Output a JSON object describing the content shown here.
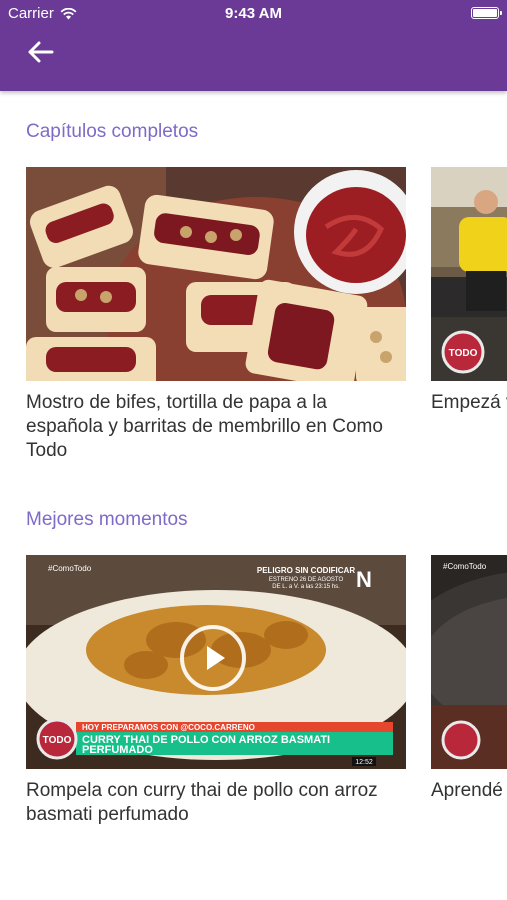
{
  "status_bar": {
    "carrier": "Carrier",
    "time": "9:43 AM"
  },
  "sections": [
    {
      "title": "Capítulos completos",
      "cards": [
        {
          "caption": "Mostro de bifes, tortilla de papa a la española y barritas de membrillo en Como Todo"
        },
        {
          "caption": "Empezá variedad",
          "badge": "TODO"
        }
      ]
    },
    {
      "title": "Mejores momentos",
      "cards": [
        {
          "caption": "Rompela con curry thai de pollo con arroz basmati perfumado",
          "hashtag": "#ComoTodo",
          "promo_title": "PELIGRO SIN CODIFICAR",
          "promo_sub": "ESTRENO 26 DE AGOSTO",
          "promo_sub2": "DE L. a V. a las 23:15 hs.",
          "promo_logo": "N",
          "banner_small": "HOY PREPARAMOS CON @COCO.CARRENO",
          "banner_line1": "CURRY THAI DE POLLO CON ARROZ BASMATI",
          "banner_line2": "PERFUMADO",
          "badge": "TODO",
          "clock": "12:52"
        },
        {
          "caption": "Aprendé lasagna champig",
          "hashtag": "#ComoTodo"
        }
      ]
    }
  ],
  "colors": {
    "appbar": "#6a3a96",
    "section_title": "#7e6bc7",
    "caption": "#333333"
  },
  "icons": {
    "back": "arrow-left-icon",
    "wifi": "wifi-icon",
    "battery": "battery-icon",
    "play": "play-icon"
  }
}
